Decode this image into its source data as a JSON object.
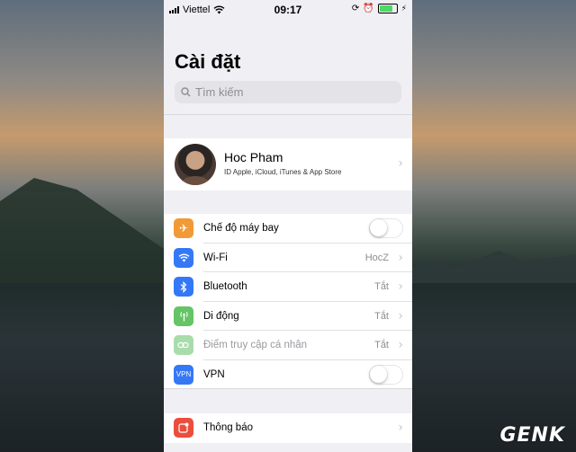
{
  "status_bar": {
    "carrier": "Viettel",
    "time": "09:17",
    "battery_level": 0.9
  },
  "title": "Cài đặt",
  "search": {
    "placeholder": "Tìm kiếm"
  },
  "profile": {
    "name": "Hoc Pham",
    "subtitle": "ID Apple, iCloud, iTunes & App Store"
  },
  "settings": [
    {
      "label": "Chế độ máy bay",
      "control": "toggle",
      "on": false,
      "icon": "airplane-icon",
      "color": "#f19a37"
    },
    {
      "label": "Wi-Fi",
      "value": "HocZ",
      "icon": "wifi-icon",
      "color": "#3478f6"
    },
    {
      "label": "Bluetooth",
      "value": "Tắt",
      "icon": "bluetooth-icon",
      "color": "#3478f6"
    },
    {
      "label": "Di động",
      "value": "Tắt",
      "icon": "cellular-icon",
      "color": "#65c466"
    },
    {
      "label": "Điểm truy cập cá nhân",
      "value": "Tắt",
      "icon": "hotspot-icon",
      "color": "#a8dcaa",
      "disabled": true
    },
    {
      "label": "VPN",
      "control": "toggle",
      "on": false,
      "icon": "vpn-icon",
      "icon_text": "VPN",
      "color": "#3478f6"
    }
  ],
  "notifications": {
    "label": "Thông báo",
    "icon": "notifications-icon",
    "color": "#eb4e3d"
  },
  "watermark": "GENK"
}
